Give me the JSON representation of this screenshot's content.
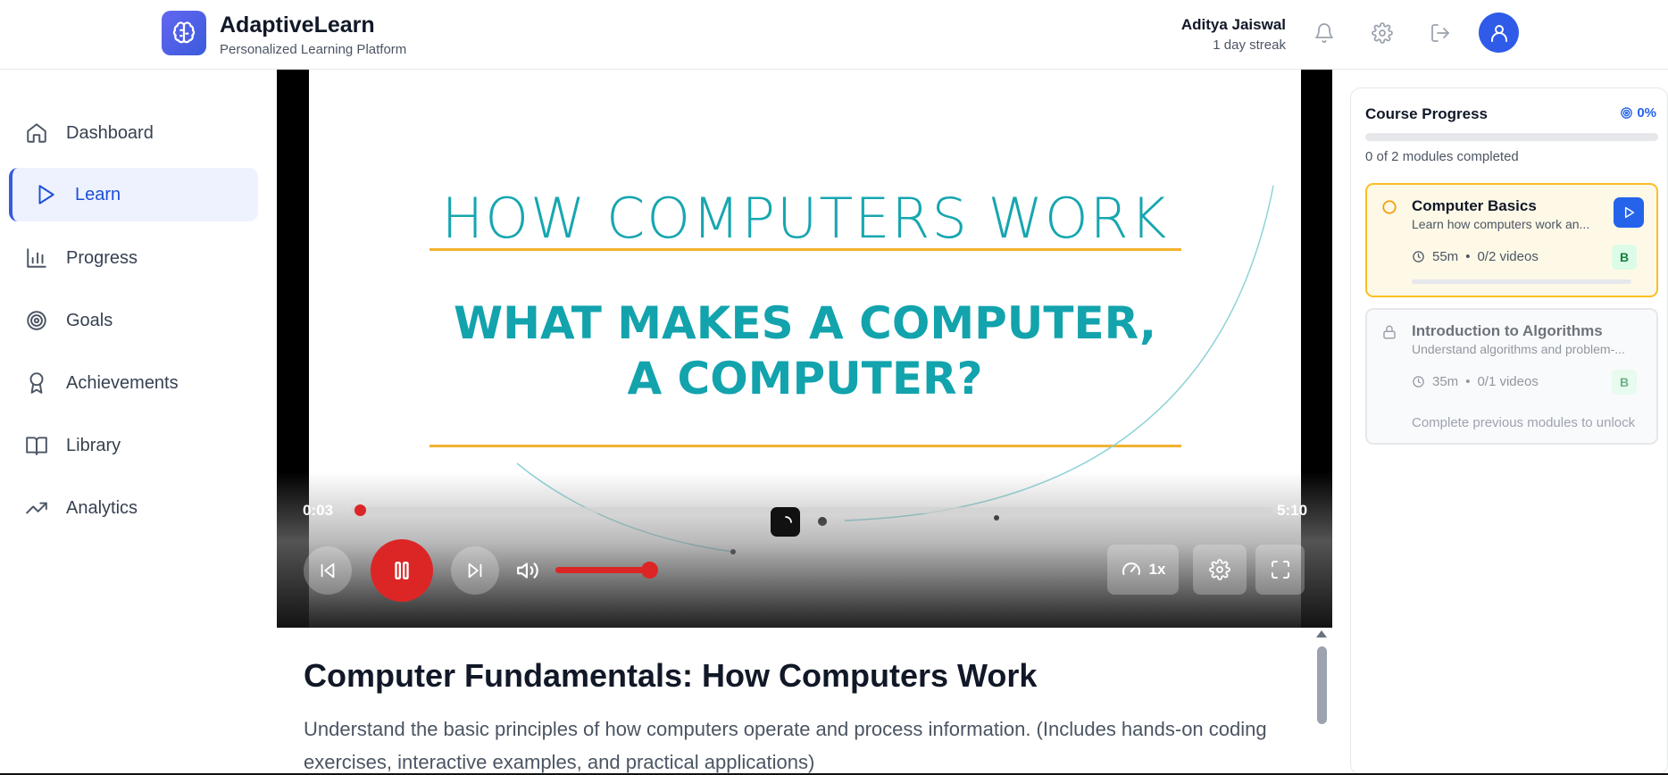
{
  "app": {
    "name": "AdaptiveLearn",
    "tagline": "Personalized Learning Platform"
  },
  "user": {
    "name": "Aditya Jaiswal",
    "streak": "1 day streak"
  },
  "header_icons": [
    "bell-icon",
    "gear-icon",
    "logout-icon",
    "user-icon"
  ],
  "sidebar": {
    "items": [
      {
        "label": "Dashboard",
        "icon": "home-icon",
        "active": false
      },
      {
        "label": "Learn",
        "icon": "play-icon",
        "active": true
      },
      {
        "label": "Progress",
        "icon": "bar-chart-icon",
        "active": false
      },
      {
        "label": "Goals",
        "icon": "target-icon",
        "active": false
      },
      {
        "label": "Achievements",
        "icon": "award-icon",
        "active": false
      },
      {
        "label": "Library",
        "icon": "book-icon",
        "active": false
      },
      {
        "label": "Analytics",
        "icon": "trending-up-icon",
        "active": false
      }
    ]
  },
  "video": {
    "slide_title": "HOW COMPUTERS WORK",
    "slide_heading_line1": "WHAT MAKES A COMPUTER,",
    "slide_heading_line2": "A COMPUTER?",
    "current_time": "0:03",
    "duration": "5:10",
    "progress_fraction": 0.01,
    "volume_fraction": 0.85,
    "speed": "1x",
    "state": "playing"
  },
  "course": {
    "title": "Computer Fundamentals: How Computers Work",
    "description": "Understand the basic principles of how computers operate and process information. (Includes hands-on coding exercises, interactive examples, and practical applications)"
  },
  "progress_panel": {
    "title": "Course Progress",
    "percent": "0%",
    "count_text": "0 of 2 modules completed",
    "modules": [
      {
        "title": "Computer Basics",
        "description": "Learn how computers work an...",
        "duration": "55m",
        "videos": "0/2 videos",
        "level": "B",
        "status": "current"
      },
      {
        "title": "Introduction to Algorithms",
        "description": "Understand algorithms and problem-...",
        "duration": "35m",
        "videos": "0/1 videos",
        "level": "B",
        "status": "locked",
        "note": "Complete previous modules to unlock"
      }
    ]
  },
  "colors": {
    "primary": "#2563eb",
    "accent_red": "#dc2626",
    "slide_teal": "#16a6b0",
    "slide_gold": "#f2b22e",
    "current_module_bg": "#fef9e7",
    "current_module_border": "#fbbf24"
  }
}
